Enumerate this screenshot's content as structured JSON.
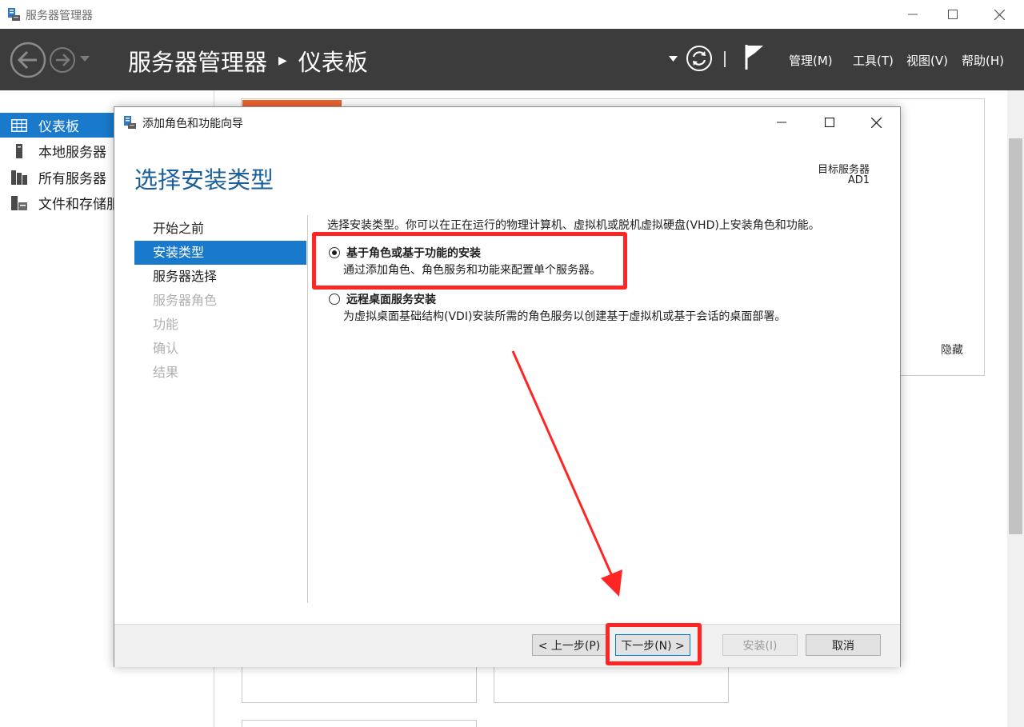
{
  "window": {
    "title": "服务器管理器"
  },
  "header": {
    "breadcrumb": [
      "服务器管理器",
      "仪表板"
    ],
    "menus": [
      "管理(M)",
      "工具(T)",
      "视图(V)",
      "帮助(H)"
    ]
  },
  "sidebar": {
    "items": [
      {
        "label": "仪表板",
        "active": true
      },
      {
        "label": "本地服务器"
      },
      {
        "label": "所有服务器"
      },
      {
        "label": "文件和存储服"
      }
    ]
  },
  "background": {
    "hide_label": "隐藏"
  },
  "dialog": {
    "title": "添加角色和功能向导",
    "heading": "选择安装类型",
    "target_label": "目标服务器",
    "target_value": "AD1",
    "steps": [
      {
        "label": "开始之前",
        "state": "normal"
      },
      {
        "label": "安装类型",
        "state": "active"
      },
      {
        "label": "服务器选择",
        "state": "normal"
      },
      {
        "label": "服务器角色",
        "state": "disabled"
      },
      {
        "label": "功能",
        "state": "disabled"
      },
      {
        "label": "确认",
        "state": "disabled"
      },
      {
        "label": "结果",
        "state": "disabled"
      }
    ],
    "intro": "选择安装类型。你可以在正在运行的物理计算机、虚拟机或脱机虚拟硬盘(VHD)上安装角色和功能。",
    "options": [
      {
        "label": "基于角色或基于功能的安装",
        "description": "通过添加角色、角色服务和功能来配置单个服务器。",
        "selected": true
      },
      {
        "label": "远程桌面服务安装",
        "description": "为虚拟桌面基础结构(VDI)安装所需的角色服务以创建基于虚拟机或基于会话的桌面部署。",
        "selected": false
      }
    ],
    "buttons": {
      "previous": "< 上一步(P)",
      "next": "下一步(N) >",
      "install": "安装(I)",
      "cancel": "取消"
    }
  },
  "colors": {
    "header_bg": "#3c3c3c",
    "accent_blue": "#1979ca",
    "heading_blue": "#1a5e9a",
    "annotation_red": "#ff2525",
    "tile_orange": "#f0642d"
  }
}
